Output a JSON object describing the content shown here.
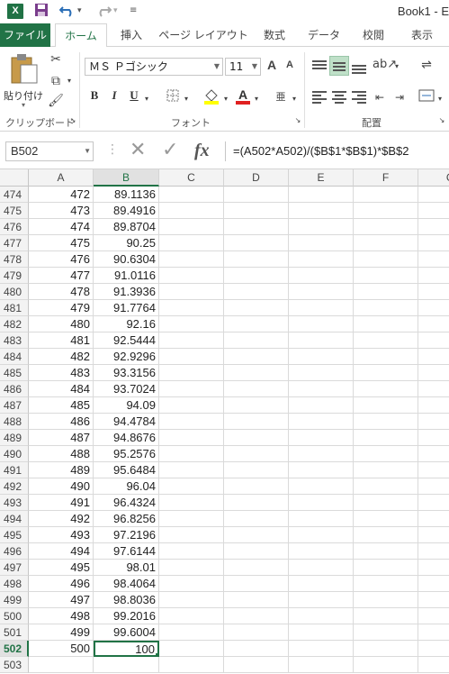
{
  "titlebar": {
    "app_icon": "X",
    "title": "Book1 - E",
    "save_icon": "save-icon",
    "undo_icon": "undo-icon",
    "redo_icon": "redo-icon"
  },
  "tabs": [
    {
      "label": "ファイル"
    },
    {
      "label": "ホーム"
    },
    {
      "label": "挿入"
    },
    {
      "label": "ページ レイアウト"
    },
    {
      "label": "数式"
    },
    {
      "label": "データ"
    },
    {
      "label": "校閲"
    },
    {
      "label": "表示"
    }
  ],
  "ribbon": {
    "clipboard": {
      "paste_label": "貼り付け",
      "group_label": "クリップボード"
    },
    "font": {
      "name": "ＭＳ Ｐゴシック",
      "size": "11",
      "bold": "B",
      "italic": "I",
      "underline": "U",
      "group_label": "フォント",
      "grow": "A",
      "shrink": "A"
    },
    "alignment": {
      "group_label": "配置"
    }
  },
  "formula_bar": {
    "name_box": "B502",
    "cancel": "✕",
    "enter": "✓",
    "fx": "fx",
    "formula": "=(A502*A502)/($B$1*$B$1)*$B$2"
  },
  "columns": [
    "A",
    "B",
    "C",
    "D",
    "E",
    "F",
    "G"
  ],
  "selected_column": "B",
  "selected_row": "502",
  "rows": [
    {
      "num": "474",
      "a": "472",
      "b": "89.1136"
    },
    {
      "num": "475",
      "a": "473",
      "b": "89.4916"
    },
    {
      "num": "476",
      "a": "474",
      "b": "89.8704"
    },
    {
      "num": "477",
      "a": "475",
      "b": "90.25"
    },
    {
      "num": "478",
      "a": "476",
      "b": "90.6304"
    },
    {
      "num": "479",
      "a": "477",
      "b": "91.0116"
    },
    {
      "num": "480",
      "a": "478",
      "b": "91.3936"
    },
    {
      "num": "481",
      "a": "479",
      "b": "91.7764"
    },
    {
      "num": "482",
      "a": "480",
      "b": "92.16"
    },
    {
      "num": "483",
      "a": "481",
      "b": "92.5444"
    },
    {
      "num": "484",
      "a": "482",
      "b": "92.9296"
    },
    {
      "num": "485",
      "a": "483",
      "b": "93.3156"
    },
    {
      "num": "486",
      "a": "484",
      "b": "93.7024"
    },
    {
      "num": "487",
      "a": "485",
      "b": "94.09"
    },
    {
      "num": "488",
      "a": "486",
      "b": "94.4784"
    },
    {
      "num": "489",
      "a": "487",
      "b": "94.8676"
    },
    {
      "num": "490",
      "a": "488",
      "b": "95.2576"
    },
    {
      "num": "491",
      "a": "489",
      "b": "95.6484"
    },
    {
      "num": "492",
      "a": "490",
      "b": "96.04"
    },
    {
      "num": "493",
      "a": "491",
      "b": "96.4324"
    },
    {
      "num": "494",
      "a": "492",
      "b": "96.8256"
    },
    {
      "num": "495",
      "a": "493",
      "b": "97.2196"
    },
    {
      "num": "496",
      "a": "494",
      "b": "97.6144"
    },
    {
      "num": "497",
      "a": "495",
      "b": "98.01"
    },
    {
      "num": "498",
      "a": "496",
      "b": "98.4064"
    },
    {
      "num": "499",
      "a": "497",
      "b": "98.8036"
    },
    {
      "num": "500",
      "a": "498",
      "b": "99.2016"
    },
    {
      "num": "501",
      "a": "499",
      "b": "99.6004"
    },
    {
      "num": "502",
      "a": "500",
      "b": "100"
    },
    {
      "num": "503",
      "a": "",
      "b": ""
    }
  ]
}
